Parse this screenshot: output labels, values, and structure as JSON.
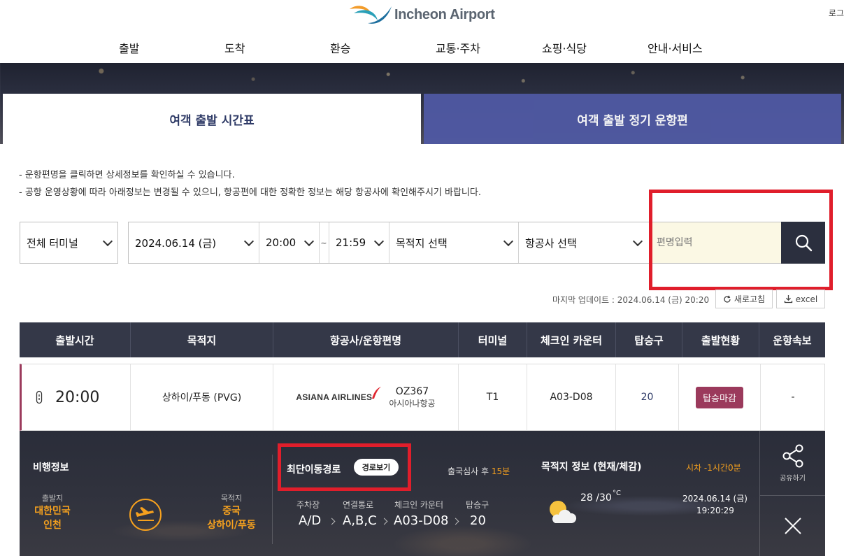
{
  "header": {
    "logo_text": "Incheon Airport",
    "login": "로그",
    "nav": [
      "출발",
      "도착",
      "환승",
      "교통·주차",
      "쇼핑·식당",
      "안내·서비스"
    ]
  },
  "tabs": {
    "active": "여객 출발 시간표",
    "inactive": "여객 출발 정기 운항편"
  },
  "notices": [
    "- 운항편명을 클릭하면 상세정보를 확인하실 수 있습니다.",
    "- 공항 운영상황에 따라 아래정보는 변경될 수 있으니, 항공편에 대한 정확한 정보는 해당 항공사에 확인해주시기 바랍니다."
  ],
  "filters": {
    "terminal": "전체 터미널",
    "date": "2024.06.14 (금)",
    "time_from": "20:00",
    "tilde": "~",
    "time_to": "21:59",
    "destination": "목적지 선택",
    "airline": "항공사 선택",
    "flight_placeholder": "편명입력"
  },
  "update": {
    "text": "마지막 업데이트 : 2024.06.14 (금) 20:20",
    "refresh_label": "새로고침",
    "excel_label": "excel"
  },
  "table": {
    "headers": [
      "출발시간",
      "목적지",
      "항공사/운항편명",
      "터미널",
      "체크인 카운터",
      "탑승구",
      "출발현황",
      "운항속보"
    ],
    "row": {
      "time": "20:00",
      "destination": "상하이/푸동 (PVG)",
      "airline_logo": "ASIANA AIRLINES",
      "flight_no": "OZ367",
      "airline_name": "아시아나항공",
      "terminal": "T1",
      "counter": "A03-D08",
      "gate": "20",
      "status": "탑승마감",
      "notice": "-"
    }
  },
  "detail": {
    "flight_info_title": "비행정보",
    "origin_label": "출발지",
    "origin_country": "대한민국",
    "origin_city": "인천",
    "dest_label": "목적지",
    "dest_country": "중국",
    "dest_city": "상하이/푸동",
    "route_title": "최단이동경로",
    "route_button": "경로보기",
    "immigration_prefix": "출국심사 후",
    "immigration_minutes": "15분",
    "route_steps": [
      {
        "label": "주차장",
        "value": "A/D"
      },
      {
        "label": "연결통로",
        "value": "A,B,C"
      },
      {
        "label": "체크인 카운터",
        "value": "A03-D08"
      },
      {
        "label": "탑승구",
        "value": "20"
      }
    ],
    "dest_info_title": "목적지 정보 (현재/체감)",
    "time_diff": "시차 -1시간0분",
    "temperature": "28 /30",
    "temp_unit": "°C",
    "date": "2024.06.14 (금)",
    "clock": "19:20:29",
    "share_label": "공유하기"
  },
  "colors": {
    "accent_navy": "#343848",
    "tab_blue": "#4f59a3",
    "status_magenta": "#9b3a5c",
    "highlight_red": "#e01e2b",
    "orange": "#f6a11e"
  }
}
